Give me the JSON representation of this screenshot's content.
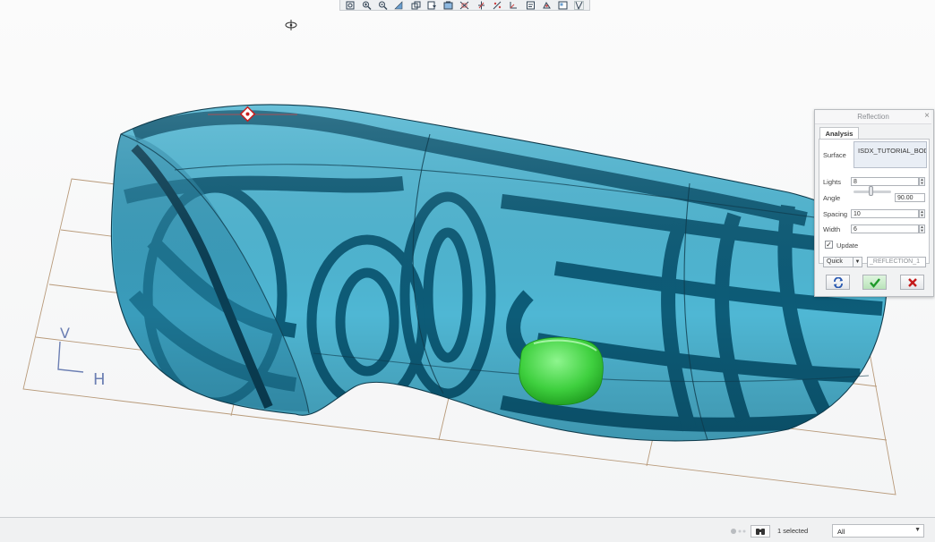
{
  "toolbar": {
    "icons": [
      "refit-icon",
      "zoom-in-icon",
      "zoom-out-icon",
      "repaint-icon",
      "orient-icon",
      "saved-views-icon",
      "display-style-icon",
      "plane-display-icon",
      "axis-display-icon",
      "point-display-icon",
      "csys-display-icon",
      "annotation-display-icon",
      "spin-center-icon",
      "view-manager-icon",
      "model-display-icon"
    ]
  },
  "dialog": {
    "title": "Reflection",
    "close": "×",
    "tab": "Analysis",
    "surface_label": "Surface",
    "surface_value": "ISDX_TUTORIAL_BOD",
    "lights_label": "Lights",
    "lights_value": "8",
    "angle_label": "Angle",
    "angle_value": "90.00",
    "angle_slider_fraction": 0.5,
    "spacing_label": "Spacing",
    "spacing_value": "10",
    "width_label": "Width",
    "width_value": "6",
    "update_label": "Update",
    "update_checked": true,
    "mode_value": "Quick",
    "name_value": "_REFLECTION_1"
  },
  "triad": {
    "v": "V",
    "h": "H"
  },
  "status": {
    "selected": "1 selected",
    "filter": "All"
  },
  "colors": {
    "stripe_light": "#4fb7d4",
    "stripe_dark": "#0d5c78",
    "accent_green": "#3fd03f",
    "datum_plane": "#b89a7a"
  }
}
